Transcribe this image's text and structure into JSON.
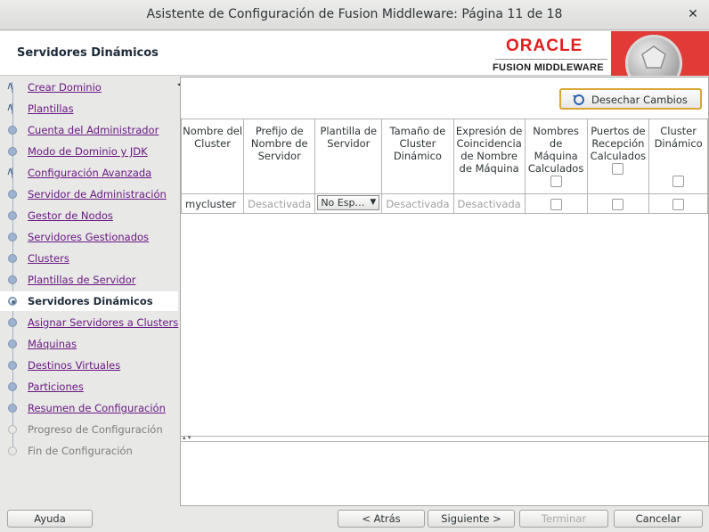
{
  "window": {
    "title": "Asistente de Configuración de Fusion Middleware: Página 11 de 18",
    "close_glyph": "✕"
  },
  "header": {
    "page_title": "Servidores Dinámicos",
    "brand_name": "ORACLE",
    "brand_product": "FUSION MIDDLEWARE"
  },
  "nav": {
    "items": [
      {
        "label": "Crear Dominio",
        "state": "done"
      },
      {
        "label": "Plantillas",
        "state": "done"
      },
      {
        "label": "Cuenta del Administrador",
        "state": "done"
      },
      {
        "label": "Modo de Dominio y JDK",
        "state": "done"
      },
      {
        "label": "Configuración Avanzada",
        "state": "done"
      },
      {
        "label": "Servidor de Administración",
        "state": "done"
      },
      {
        "label": "Gestor de Nodos",
        "state": "done"
      },
      {
        "label": "Servidores Gestionados",
        "state": "done"
      },
      {
        "label": "Clusters",
        "state": "done"
      },
      {
        "label": "Plantillas de Servidor",
        "state": "done"
      },
      {
        "label": "Servidores Dinámicos",
        "state": "current"
      },
      {
        "label": "Asignar Servidores a Clusters",
        "state": "done"
      },
      {
        "label": "Máquinas",
        "state": "done"
      },
      {
        "label": "Destinos Virtuales",
        "state": "done"
      },
      {
        "label": "Particiones",
        "state": "done"
      },
      {
        "label": "Resumen de Configuración",
        "state": "done"
      },
      {
        "label": "Progreso de Configuración",
        "state": "disabled"
      },
      {
        "label": "Fin de Configuración",
        "state": "disabled"
      }
    ]
  },
  "toolbar": {
    "discard_label": "Desechar Cambios",
    "discard_icon": "undo-icon"
  },
  "table": {
    "columns": [
      "Nombre del Cluster",
      "Prefijo de Nombre de Servidor",
      "Plantilla de Servidor",
      "Tamaño de Cluster Dinámico",
      "Expresión de Coincidencia de Nombre de Máquina",
      "Nombres de Máquina Calculados",
      "Puertos de Recepción Calculados",
      "Cluster Dinámico"
    ],
    "rows": [
      {
        "cluster_name": "mycluster",
        "prefix": "Desactivada",
        "template": "No Esp…",
        "size": "Desactivada",
        "expression": "Desactivada",
        "machine_names": false,
        "listen_ports": false,
        "dynamic": false
      }
    ]
  },
  "footer": {
    "help": "Ayuda",
    "back": "< Atrás",
    "next": "Siguiente >",
    "finish": "Terminar",
    "cancel": "Cancelar"
  },
  "colors": {
    "brand_red": "#e01e1e",
    "nav_link": "#6a1a83",
    "focus_border": "#d8a537"
  }
}
